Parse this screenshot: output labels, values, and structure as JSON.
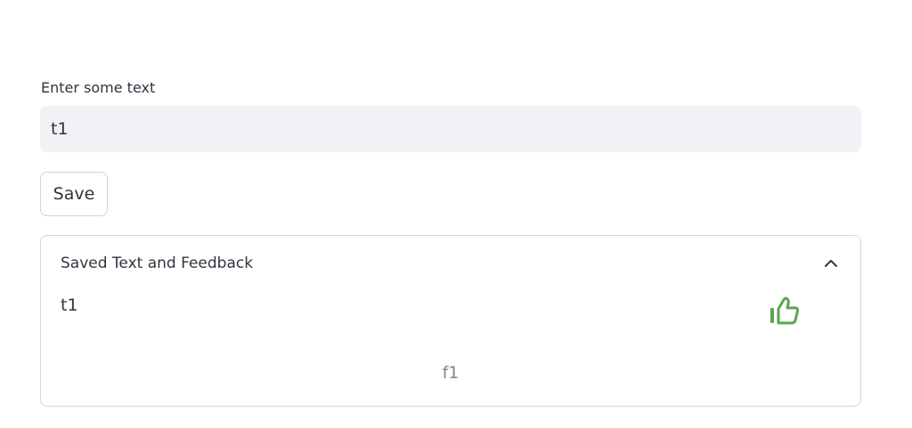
{
  "input": {
    "label": "Enter some text",
    "value": "t1"
  },
  "save_button": {
    "label": "Save"
  },
  "expander": {
    "title": "Saved Text and Feedback",
    "expanded": true,
    "chevron_icon": "chevron-up-icon",
    "saved_text": "t1",
    "feedback_icon": "thumbs-up-icon",
    "feedback_icon_color": "#5aa552",
    "feedback_text": "f1"
  }
}
